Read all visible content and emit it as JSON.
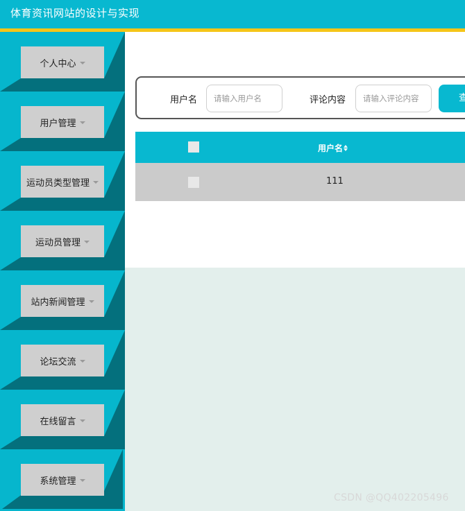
{
  "header": {
    "title": "体育资讯网站的设计与实现"
  },
  "sidebar": {
    "items": [
      {
        "label": "个人中心"
      },
      {
        "label": "用户管理"
      },
      {
        "label": "运动员类型管理"
      },
      {
        "label": "运动员管理"
      },
      {
        "label": "站内新闻管理"
      },
      {
        "label": "论坛交流"
      },
      {
        "label": "在线留言"
      },
      {
        "label": "系统管理"
      }
    ]
  },
  "search": {
    "username_label": "用户名",
    "username_placeholder": "请输入用户名",
    "content_label": "评论内容",
    "content_placeholder": "请输入评论内容",
    "search_button": "查"
  },
  "table": {
    "columns": [
      {
        "label": "用户名"
      }
    ],
    "rows": [
      {
        "username": "111"
      }
    ]
  },
  "watermark": "CSDN @QQ402205496",
  "colors": {
    "accent": "#08b8d0",
    "accent_dark": "#04707d",
    "header_stripe": "#f5c518",
    "page_bg": "#e3efec"
  }
}
